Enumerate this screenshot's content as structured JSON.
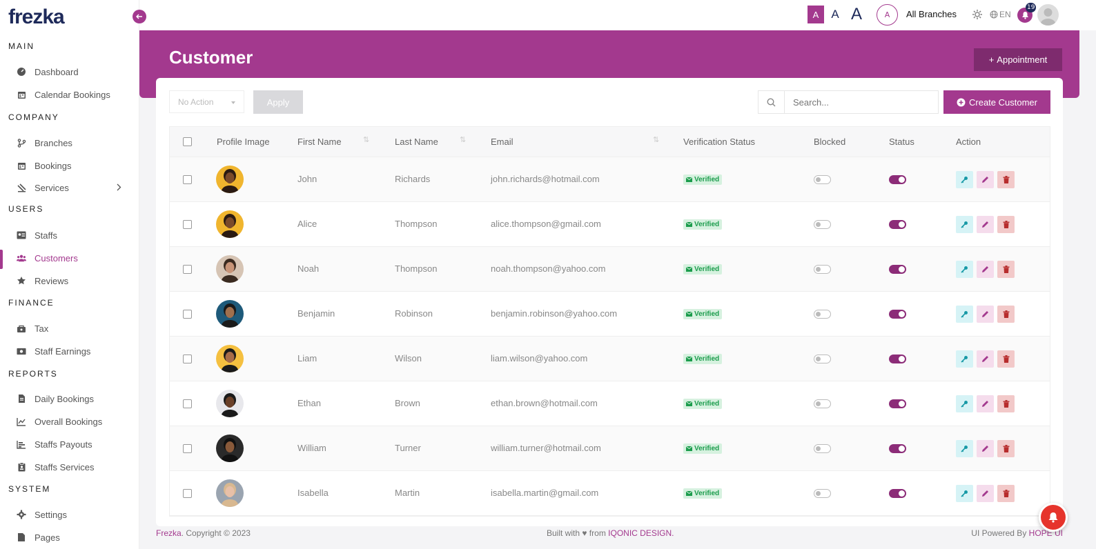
{
  "app": {
    "logo": "frezka"
  },
  "sidebar": {
    "sections": [
      {
        "title": "MAIN"
      },
      {
        "title": "COMPANY"
      },
      {
        "title": "USERS"
      },
      {
        "title": "FINANCE"
      },
      {
        "title": "REPORTS"
      },
      {
        "title": "SYSTEM"
      }
    ],
    "items": [
      {
        "label": "Dashboard",
        "icon": "dashboard-icon"
      },
      {
        "label": "Calendar Bookings",
        "icon": "calendar-icon"
      },
      {
        "label": "Branches",
        "icon": "branch-icon"
      },
      {
        "label": "Bookings",
        "icon": "calendar-icon"
      },
      {
        "label": "Services",
        "icon": "services-icon"
      },
      {
        "label": "Staffs",
        "icon": "id-card-icon"
      },
      {
        "label": "Customers",
        "icon": "users-icon",
        "active": true
      },
      {
        "label": "Reviews",
        "icon": "star-icon"
      },
      {
        "label": "Tax",
        "icon": "tax-icon"
      },
      {
        "label": "Staff Earnings",
        "icon": "money-icon"
      },
      {
        "label": "Daily Bookings",
        "icon": "document-icon"
      },
      {
        "label": "Overall Bookings",
        "icon": "chart-line-icon"
      },
      {
        "label": "Staffs Payouts",
        "icon": "chart-bar-icon"
      },
      {
        "label": "Staffs Services",
        "icon": "clipboard-icon"
      },
      {
        "label": "Settings",
        "icon": "gear-icon"
      },
      {
        "label": "Pages",
        "icon": "pages-icon"
      }
    ]
  },
  "topbar": {
    "font_small": "A",
    "font_medium": "A",
    "font_large": "A",
    "branch_initial": "A",
    "branch_label": "All Branches",
    "language": "EN",
    "notification_count": "19"
  },
  "page": {
    "title": "Customer",
    "appointment_button": "Appointment",
    "bulk_action_placeholder": "No Action",
    "apply_button": "Apply",
    "search_placeholder": "Search...",
    "create_button": "Create Customer"
  },
  "table": {
    "columns": [
      "Profile Image",
      "First Name",
      "Last Name",
      "Email",
      "Verification Status",
      "Blocked",
      "Status",
      "Action"
    ],
    "rows": [
      {
        "first": "John",
        "last": "Richards",
        "email": "john.richards@hotmail.com",
        "verification": "Verified",
        "blocked": false,
        "status": true,
        "avatar_bg": "#f0b52e",
        "skin": "#7a4a2a",
        "hair": "#2a1a12"
      },
      {
        "first": "Alice",
        "last": "Thompson",
        "email": "alice.thompson@gmail.com",
        "verification": "Verified",
        "blocked": false,
        "status": true,
        "avatar_bg": "#f0b52e",
        "skin": "#7a4a2a",
        "hair": "#2a1a12"
      },
      {
        "first": "Noah",
        "last": "Thompson",
        "email": "noah.thompson@yahoo.com",
        "verification": "Verified",
        "blocked": false,
        "status": true,
        "avatar_bg": "#d6c4b4",
        "skin": "#c89478",
        "hair": "#3a2a20"
      },
      {
        "first": "Benjamin",
        "last": "Robinson",
        "email": "benjamin.robinson@yahoo.com",
        "verification": "Verified",
        "blocked": false,
        "status": true,
        "avatar_bg": "#1e5a7a",
        "skin": "#a0704e",
        "hair": "#1a1a1a"
      },
      {
        "first": "Liam",
        "last": "Wilson",
        "email": "liam.wilson@yahoo.com",
        "verification": "Verified",
        "blocked": false,
        "status": true,
        "avatar_bg": "#f5c040",
        "skin": "#a86c48",
        "hair": "#1a1a1a"
      },
      {
        "first": "Ethan",
        "last": "Brown",
        "email": "ethan.brown@hotmail.com",
        "verification": "Verified",
        "blocked": false,
        "status": true,
        "avatar_bg": "#e8e8ec",
        "skin": "#6a4028",
        "hair": "#1a1a1a"
      },
      {
        "first": "William",
        "last": "Turner",
        "email": "william.turner@hotmail.com",
        "verification": "Verified",
        "blocked": false,
        "status": true,
        "avatar_bg": "#2a2a2a",
        "skin": "#8a5a3a",
        "hair": "#111111"
      },
      {
        "first": "Isabella",
        "last": "Martin",
        "email": "isabella.martin@gmail.com",
        "verification": "Verified",
        "blocked": false,
        "status": true,
        "avatar_bg": "#9aa4b0",
        "skin": "#e8c0a8",
        "hair": "#d8b890"
      }
    ]
  },
  "footer": {
    "brand": "Frezka",
    "copyright": ". Copyright © 2023",
    "built_prefix": "Built with ♥ from ",
    "built_brand": "IQONIC DESIGN.",
    "powered_prefix": "UI Powered By ",
    "powered_brand": "HOPE UI"
  },
  "colors": {
    "accent": "#a3398e",
    "navy": "#1e2a5a",
    "success": "#1b9c4c",
    "danger": "#b72d2d",
    "info": "#1699a6"
  }
}
